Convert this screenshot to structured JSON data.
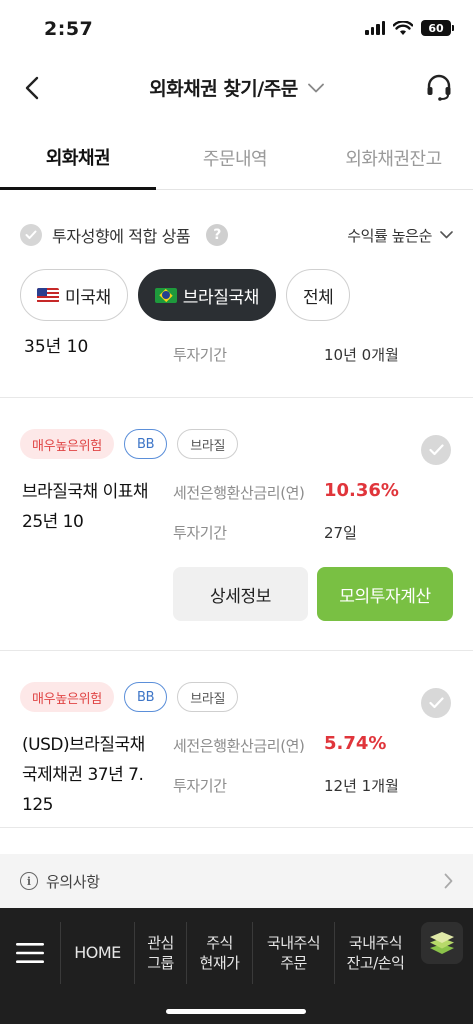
{
  "status_bar": {
    "time": "2:57",
    "battery": "60"
  },
  "header": {
    "title": "외화채권 찾기/주문"
  },
  "tabs": [
    {
      "label": "외화채권"
    },
    {
      "label": "주문내역"
    },
    {
      "label": "외화채권잔고"
    }
  ],
  "filter": {
    "suitable_label": "투자성향에 적합 상품",
    "help": "?",
    "sort_label": "수익률 높은순"
  },
  "chips": [
    {
      "label": "미국채",
      "flag": "us-flag"
    },
    {
      "label": "브라질국채",
      "flag": "brazil-flag"
    },
    {
      "label": "전체"
    }
  ],
  "partial_item": {
    "name_tail": "35년 10",
    "period_label": "투자기간",
    "period_value": "10년 0개월"
  },
  "products": [
    {
      "risk": "매우높은위험",
      "grade": "BB",
      "country": "브라질",
      "name_line1": "브라질국채 이표채",
      "name_line2": "25년 10",
      "rate_label": "세전은행환산금리(연)",
      "rate_value": "10.36%",
      "period_label": "투자기간",
      "period_value": "27일",
      "detail_button": "상세정보",
      "calc_button": "모의투자계산"
    },
    {
      "risk": "매우높은위험",
      "grade": "BB",
      "country": "브라질",
      "name_line1": "(USD)브라질국채",
      "name_line2": "국제채권 37년 7.",
      "name_line3": "125",
      "rate_label": "세전은행환산금리(연)",
      "rate_value": "5.74%",
      "period_label": "투자기간",
      "period_value": "12년 1개월"
    }
  ],
  "notice": {
    "info": "i",
    "label": "유의사항"
  },
  "bottom_nav": {
    "home": "HOME",
    "items": [
      {
        "label": "관심\n그룹"
      },
      {
        "label": "주식\n현재가"
      },
      {
        "label": "국내주식\n주문"
      },
      {
        "label": "국내주식\n잔고/손익"
      }
    ]
  },
  "colors": {
    "accent_green": "#79c043",
    "rate_red": "#e0353b",
    "risk_bg": "#fde8e8",
    "grade_blue": "#3d75c7",
    "nav_bg": "#1f1f1f",
    "active_chip": "#2b2f33"
  },
  "icons": [
    "back-arrow-icon",
    "chevron-down-icon",
    "headset-icon",
    "check-icon",
    "question-icon",
    "info-icon",
    "chevron-right-icon",
    "menu-icon",
    "layers-icon"
  ]
}
